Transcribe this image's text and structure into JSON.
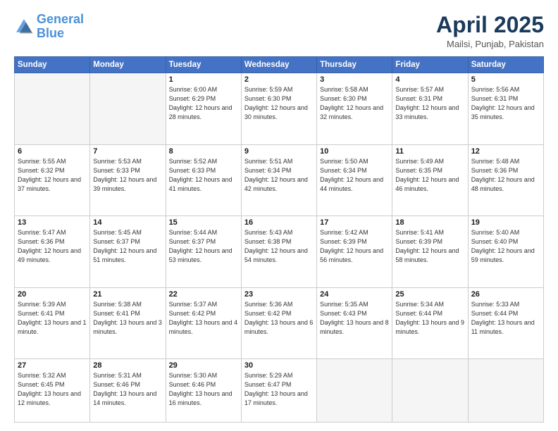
{
  "header": {
    "logo_line1": "General",
    "logo_line2": "Blue",
    "month_title": "April 2025",
    "location": "Mailsi, Punjab, Pakistan"
  },
  "days_of_week": [
    "Sunday",
    "Monday",
    "Tuesday",
    "Wednesday",
    "Thursday",
    "Friday",
    "Saturday"
  ],
  "weeks": [
    [
      {
        "day": "",
        "detail": ""
      },
      {
        "day": "",
        "detail": ""
      },
      {
        "day": "1",
        "detail": "Sunrise: 6:00 AM\nSunset: 6:29 PM\nDaylight: 12 hours\nand 28 minutes."
      },
      {
        "day": "2",
        "detail": "Sunrise: 5:59 AM\nSunset: 6:30 PM\nDaylight: 12 hours\nand 30 minutes."
      },
      {
        "day": "3",
        "detail": "Sunrise: 5:58 AM\nSunset: 6:30 PM\nDaylight: 12 hours\nand 32 minutes."
      },
      {
        "day": "4",
        "detail": "Sunrise: 5:57 AM\nSunset: 6:31 PM\nDaylight: 12 hours\nand 33 minutes."
      },
      {
        "day": "5",
        "detail": "Sunrise: 5:56 AM\nSunset: 6:31 PM\nDaylight: 12 hours\nand 35 minutes."
      }
    ],
    [
      {
        "day": "6",
        "detail": "Sunrise: 5:55 AM\nSunset: 6:32 PM\nDaylight: 12 hours\nand 37 minutes."
      },
      {
        "day": "7",
        "detail": "Sunrise: 5:53 AM\nSunset: 6:33 PM\nDaylight: 12 hours\nand 39 minutes."
      },
      {
        "day": "8",
        "detail": "Sunrise: 5:52 AM\nSunset: 6:33 PM\nDaylight: 12 hours\nand 41 minutes."
      },
      {
        "day": "9",
        "detail": "Sunrise: 5:51 AM\nSunset: 6:34 PM\nDaylight: 12 hours\nand 42 minutes."
      },
      {
        "day": "10",
        "detail": "Sunrise: 5:50 AM\nSunset: 6:34 PM\nDaylight: 12 hours\nand 44 minutes."
      },
      {
        "day": "11",
        "detail": "Sunrise: 5:49 AM\nSunset: 6:35 PM\nDaylight: 12 hours\nand 46 minutes."
      },
      {
        "day": "12",
        "detail": "Sunrise: 5:48 AM\nSunset: 6:36 PM\nDaylight: 12 hours\nand 48 minutes."
      }
    ],
    [
      {
        "day": "13",
        "detail": "Sunrise: 5:47 AM\nSunset: 6:36 PM\nDaylight: 12 hours\nand 49 minutes."
      },
      {
        "day": "14",
        "detail": "Sunrise: 5:45 AM\nSunset: 6:37 PM\nDaylight: 12 hours\nand 51 minutes."
      },
      {
        "day": "15",
        "detail": "Sunrise: 5:44 AM\nSunset: 6:37 PM\nDaylight: 12 hours\nand 53 minutes."
      },
      {
        "day": "16",
        "detail": "Sunrise: 5:43 AM\nSunset: 6:38 PM\nDaylight: 12 hours\nand 54 minutes."
      },
      {
        "day": "17",
        "detail": "Sunrise: 5:42 AM\nSunset: 6:39 PM\nDaylight: 12 hours\nand 56 minutes."
      },
      {
        "day": "18",
        "detail": "Sunrise: 5:41 AM\nSunset: 6:39 PM\nDaylight: 12 hours\nand 58 minutes."
      },
      {
        "day": "19",
        "detail": "Sunrise: 5:40 AM\nSunset: 6:40 PM\nDaylight: 12 hours\nand 59 minutes."
      }
    ],
    [
      {
        "day": "20",
        "detail": "Sunrise: 5:39 AM\nSunset: 6:41 PM\nDaylight: 13 hours\nand 1 minute."
      },
      {
        "day": "21",
        "detail": "Sunrise: 5:38 AM\nSunset: 6:41 PM\nDaylight: 13 hours\nand 3 minutes."
      },
      {
        "day": "22",
        "detail": "Sunrise: 5:37 AM\nSunset: 6:42 PM\nDaylight: 13 hours\nand 4 minutes."
      },
      {
        "day": "23",
        "detail": "Sunrise: 5:36 AM\nSunset: 6:42 PM\nDaylight: 13 hours\nand 6 minutes."
      },
      {
        "day": "24",
        "detail": "Sunrise: 5:35 AM\nSunset: 6:43 PM\nDaylight: 13 hours\nand 8 minutes."
      },
      {
        "day": "25",
        "detail": "Sunrise: 5:34 AM\nSunset: 6:44 PM\nDaylight: 13 hours\nand 9 minutes."
      },
      {
        "day": "26",
        "detail": "Sunrise: 5:33 AM\nSunset: 6:44 PM\nDaylight: 13 hours\nand 11 minutes."
      }
    ],
    [
      {
        "day": "27",
        "detail": "Sunrise: 5:32 AM\nSunset: 6:45 PM\nDaylight: 13 hours\nand 12 minutes."
      },
      {
        "day": "28",
        "detail": "Sunrise: 5:31 AM\nSunset: 6:46 PM\nDaylight: 13 hours\nand 14 minutes."
      },
      {
        "day": "29",
        "detail": "Sunrise: 5:30 AM\nSunset: 6:46 PM\nDaylight: 13 hours\nand 16 minutes."
      },
      {
        "day": "30",
        "detail": "Sunrise: 5:29 AM\nSunset: 6:47 PM\nDaylight: 13 hours\nand 17 minutes."
      },
      {
        "day": "",
        "detail": ""
      },
      {
        "day": "",
        "detail": ""
      },
      {
        "day": "",
        "detail": ""
      }
    ]
  ]
}
